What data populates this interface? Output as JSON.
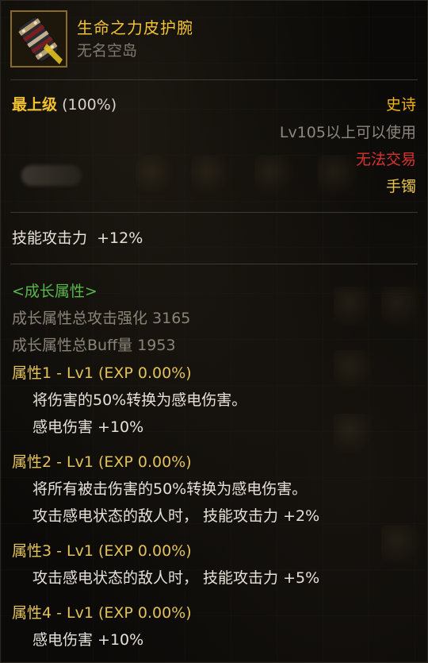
{
  "item": {
    "name": "生命之力皮护腕",
    "subtitle": "无名空岛",
    "icon": "bracer-icon"
  },
  "grade": {
    "label": "最上级",
    "percent": "(100%)"
  },
  "right_info": {
    "rarity": "史诗",
    "level_requirement": "Lv105以上可以使用",
    "trade": "无法交易",
    "slot": "手镯"
  },
  "stat": {
    "label": "技能攻击力",
    "value": "+12%"
  },
  "growth": {
    "section_title": "<成长属性>",
    "total_attack": "成长属性总攻击强化 3165",
    "total_buff": "成长属性总Buff量 1953"
  },
  "properties": [
    {
      "title": "属性1 - Lv1 (EXP 0.00%)",
      "lines": [
        "将伤害的50%转换为感电伤害。",
        "感电伤害 +10%"
      ]
    },
    {
      "title": "属性2 - Lv1 (EXP 0.00%)",
      "lines": [
        "将所有被击伤害的50%转换为感电伤害。",
        "攻击感电状态的敌人时， 技能攻击力 +2%"
      ]
    },
    {
      "title": "属性3 - Lv1 (EXP 0.00%)",
      "lines": [
        "攻击感电状态的敌人时， 技能攻击力 +5%"
      ]
    },
    {
      "title": "属性4 - Lv1 (EXP 0.00%)",
      "lines": [
        "感电伤害 +10%"
      ]
    }
  ],
  "colors": {
    "gold": "#f2c230",
    "epic": "#f2b218",
    "untradeable": "#d8322e",
    "growth_section": "#59b84a",
    "property_title": "#e2c25a"
  }
}
